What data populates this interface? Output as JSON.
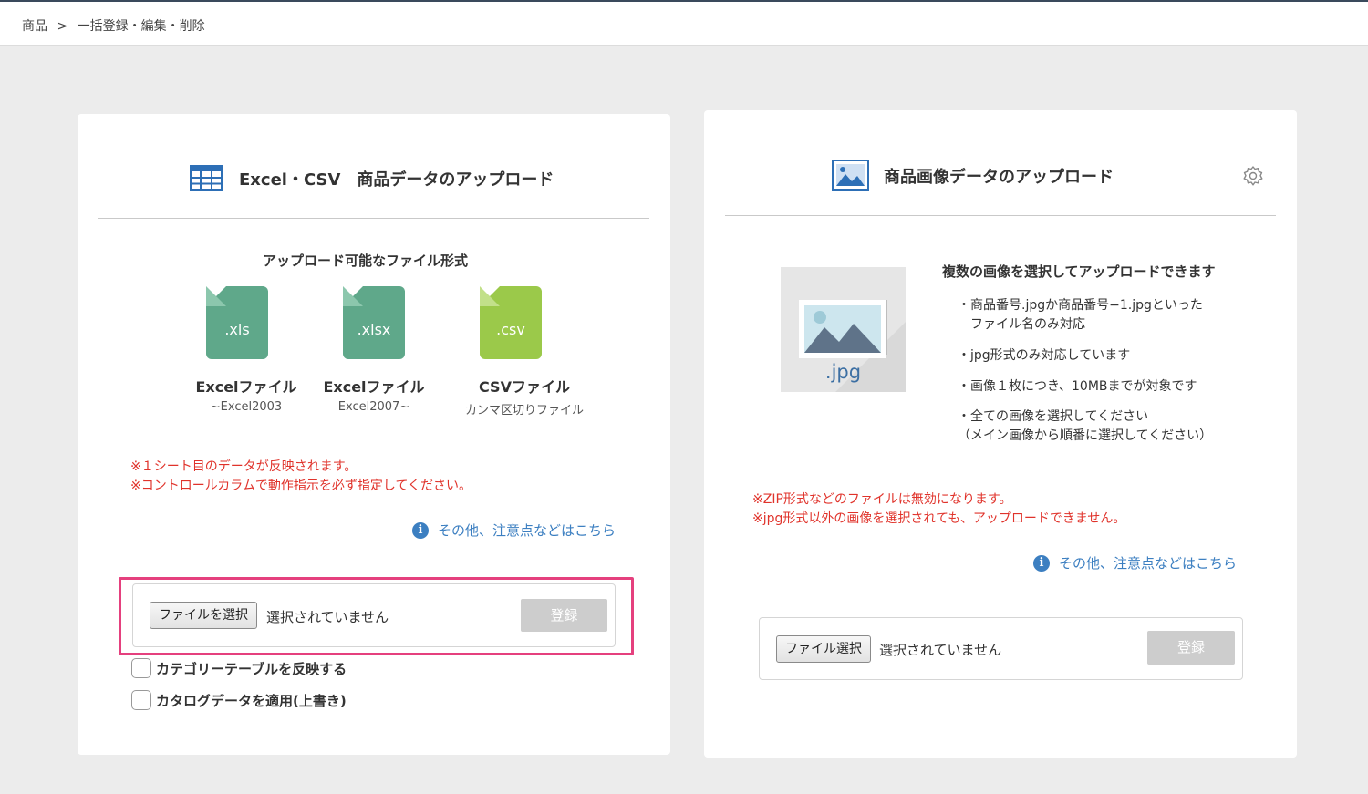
{
  "breadcrumb": {
    "root": "商品",
    "separator": ">",
    "current": "一括登録・編集・削除"
  },
  "left_panel": {
    "title": "Excel・CSV　商品データのアップロード",
    "formats_heading": "アップロード可能なファイル形式",
    "formats": [
      {
        "ext": ".xls",
        "name": "Excelファイル",
        "sub": "~Excel2003",
        "color": "#5fa88a",
        "fold": "#8cc7ad"
      },
      {
        "ext": ".xlsx",
        "name": "Excelファイル",
        "sub": "Excel2007~",
        "color": "#5fa88a",
        "fold": "#8cc7ad"
      },
      {
        "ext": ".csv",
        "name": "CSVファイル",
        "sub": "カンマ区切りファイル",
        "color": "#9bc94a",
        "fold": "#c2e08a"
      }
    ],
    "warnings": [
      "※１シート目のデータが反映されます。",
      "※コントロールカラムで動作指示を必ず指定してください。"
    ],
    "info_link": "その他、注意点などはこちら",
    "file_button": "ファイルを選択",
    "file_status": "選択されていません",
    "submit": "登録",
    "checkboxes": [
      "カテゴリーテーブルを反映する",
      "カタログデータを適用(上書き)"
    ]
  },
  "right_panel": {
    "title": "商品画像データのアップロード",
    "thumb_ext": ".jpg",
    "heading": "複数の画像を選択してアップロードできます",
    "bullets": [
      [
        "・商品番号.jpgか商品番号−1.jpgといった",
        "　ファイル名のみ対応"
      ],
      [
        "・jpg形式のみ対応しています"
      ],
      [
        "・画像１枚につき、10MBまでが対象です"
      ],
      [
        "・全ての画像を選択してください",
        "（メイン画像から順番に選択してください）"
      ]
    ],
    "warnings": [
      "※ZIP形式などのファイルは無効になります。",
      "※jpg形式以外の画像を選択されても、アップロードできません。"
    ],
    "info_link": "その他、注意点などはこちら",
    "file_button": "ファイル選択",
    "file_status": "選択されていません",
    "submit": "登録"
  },
  "colors": {
    "warning": "#e0332b",
    "link": "#3c7fc1",
    "highlight": "#e5407e",
    "icon_blue": "#2d6fb6"
  },
  "icons": [
    "table-icon",
    "image-icon",
    "gear-icon",
    "info-icon"
  ]
}
